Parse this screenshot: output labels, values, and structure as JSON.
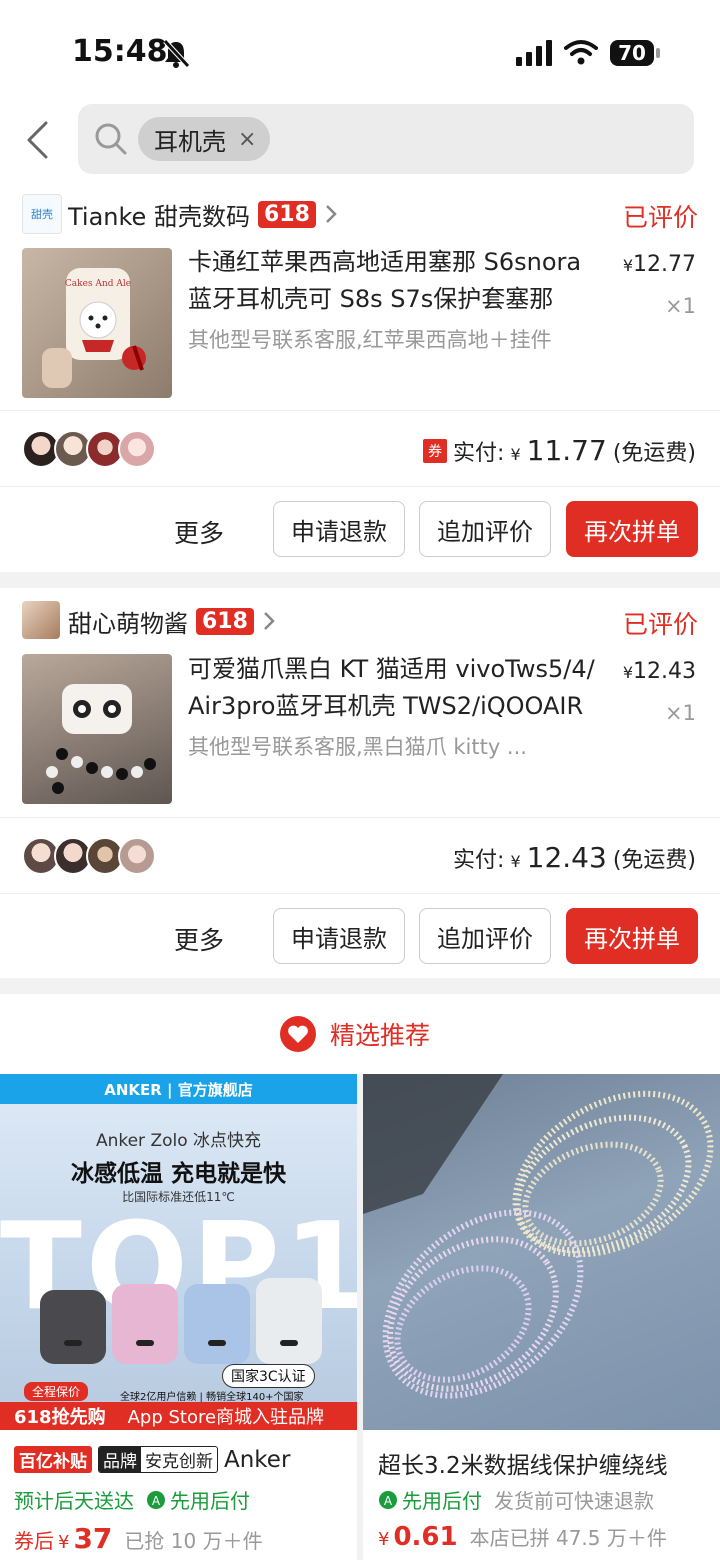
{
  "status_bar": {
    "time": "15:48",
    "battery": "70"
  },
  "search": {
    "chip_label": "耳机壳",
    "chip_close": "×"
  },
  "orders": [
    {
      "shop_name": "Tianke 甜壳数码",
      "shop_badge": "618",
      "shop_logo_text": "甜壳",
      "status": "已评价",
      "title": "卡通红苹果西高地适用塞那 S6snora 蓝牙耳机壳可 S8s S7s保护套塞那",
      "spec": "其他型号联系客服,红苹果西高地＋挂件",
      "price_symbol": "¥",
      "price": "12.77",
      "quantity": "×1",
      "coupon_label": "券",
      "paid_label": "实付:",
      "paid_symbol": "¥",
      "paid_amount": "11.77",
      "shipping": "(免运费)",
      "buttons": {
        "more": "更多",
        "refund": "申请退款",
        "review": "追加评价",
        "rebuy": "再次拼单"
      }
    },
    {
      "shop_name": "甜心萌物酱",
      "shop_badge": "618",
      "status": "已评价",
      "title": "可爱猫爪黑白 KT 猫适用 vivoTws5/4/ Air3pro蓝牙耳机壳 TWS2/iQOOAIR",
      "spec": "其他型号联系客服,黑白猫爪 kitty ...",
      "price_symbol": "¥",
      "price": "12.43",
      "quantity": "×1",
      "paid_label": "实付:",
      "paid_symbol": "¥",
      "paid_amount": "12.43",
      "shipping": "(免运费)",
      "buttons": {
        "more": "更多",
        "refund": "申请退款",
        "review": "追加评价",
        "rebuy": "再次拼单"
      }
    }
  ],
  "recommend": {
    "title": "精选推荐"
  },
  "products": [
    {
      "banner_brand": "ANKER | 官方旗舰店",
      "banner_line1": "Anker Zolo 冰点快充",
      "banner_line2": "冰感低温 充电就是快",
      "banner_line3": "比国际标准还低11℃",
      "banner_big": "TOP1",
      "banner_cert": "国家3C认证",
      "banner_users": "全球2亿用户信赖 | 畅销全球140+个国家",
      "banner_tag": "全程保价",
      "banner_bottom_left": "618抢先购",
      "banner_bottom_right": "App Store商城入驻品牌",
      "tag_billion": "百亿补贴",
      "tag_brand": "品牌",
      "tag_brand_name": "安克创新",
      "title": "Anker",
      "delivery": "预计后天送达",
      "pay_later": "先用后付",
      "price_prefix": "券后",
      "price_symbol": "¥",
      "price": "37",
      "sold": "已抢 10 万＋件"
    },
    {
      "title": "超长3.2米数据线保护缠绕线",
      "pay_later": "先用后付",
      "refund_note": "发货前可快速退款",
      "price_symbol": "¥",
      "price": "0.61",
      "sold": "本店已拼 47.5 万＋件"
    }
  ]
}
